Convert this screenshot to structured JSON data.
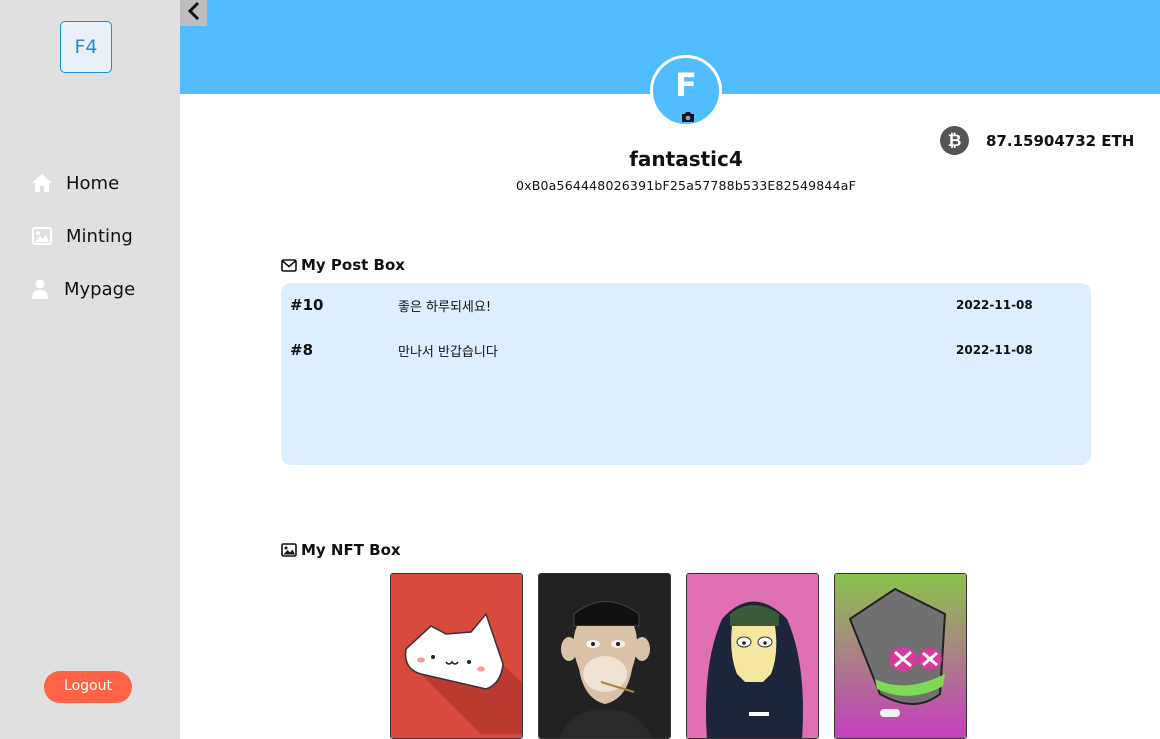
{
  "sidebar": {
    "logo": "F4",
    "items": [
      {
        "label": "Home",
        "icon": "home-icon"
      },
      {
        "label": "Minting",
        "icon": "image-icon"
      },
      {
        "label": "Mypage",
        "icon": "user-icon"
      }
    ],
    "logout_label": "Logout"
  },
  "header": {
    "banner_color": "#51bcff",
    "back_icon": "chevron-left-icon"
  },
  "profile": {
    "avatar_letter": "F",
    "username": "fantastic4",
    "address": "0xB0a564448026391bF25a57788b533E82549844aF",
    "balance": "87.15904732 ETH",
    "balance_icon": "bitcoin-icon"
  },
  "posts": {
    "title": "My Post Box",
    "items": [
      {
        "number": "#10",
        "text": "좋은 하루되세요!",
        "date": "2022-11-08"
      },
      {
        "number": "#8",
        "text": "만나서 반갑습니다",
        "date": "2022-11-08"
      }
    ]
  },
  "nfts": {
    "title": "My NFT Box",
    "items": [
      {
        "name": "nft-cat",
        "bg": "#d94a3e"
      },
      {
        "name": "nft-ape",
        "bg": "#1f1f1f"
      },
      {
        "name": "nft-skull-hoodie",
        "bg": "#e070b0"
      },
      {
        "name": "nft-zombie",
        "bg": "#8bc34a"
      }
    ]
  },
  "colors": {
    "accent": "#51bcff",
    "logout": "#ff6347",
    "post_box_bg": "#ddeeff",
    "sidebar_bg": "#e0e0e0"
  }
}
